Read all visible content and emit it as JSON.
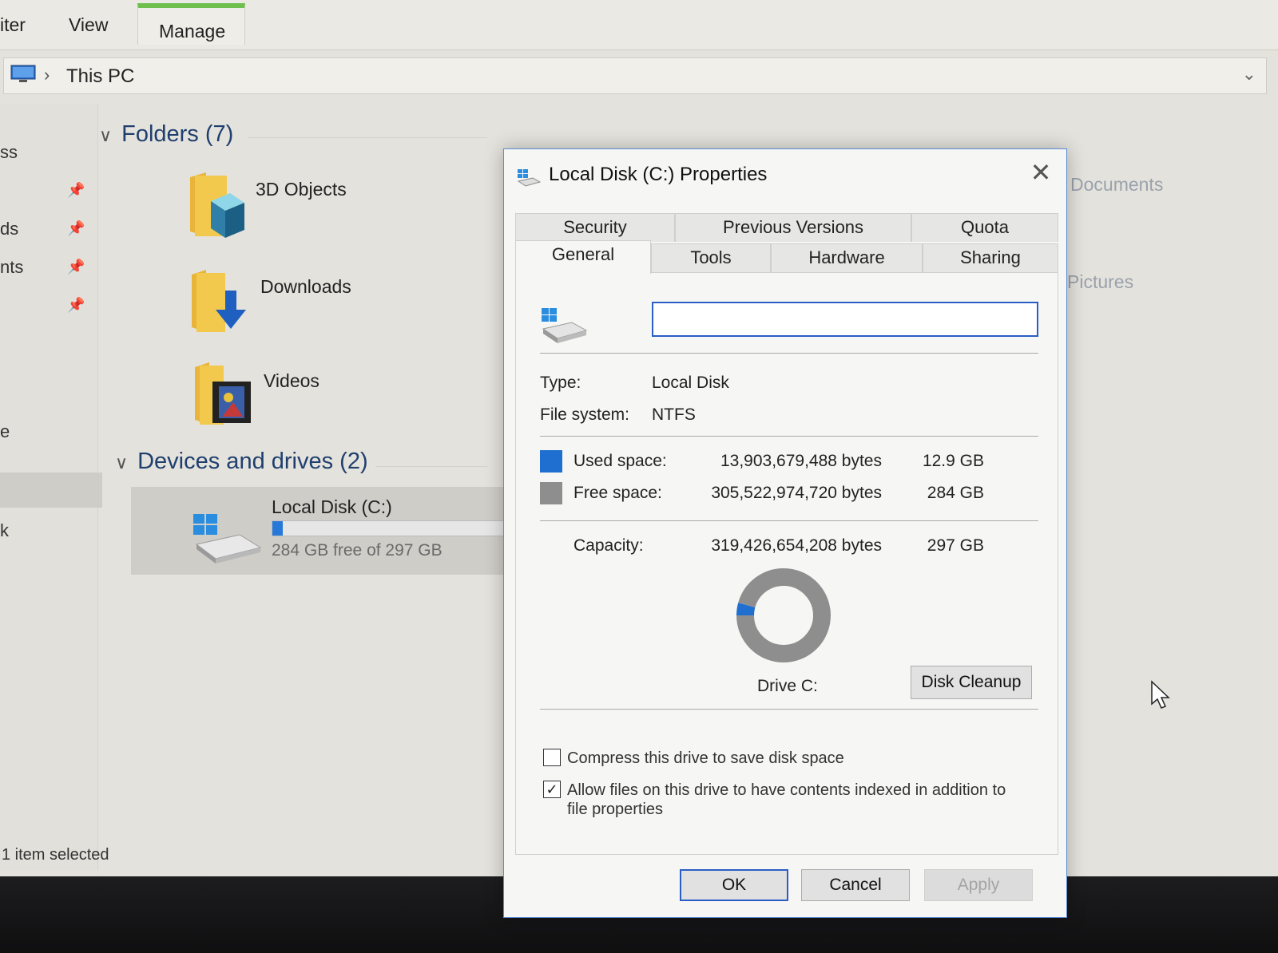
{
  "ribbon": {
    "tabs": [
      {
        "label": "iter"
      },
      {
        "label": "View"
      },
      {
        "label": "Manage"
      }
    ]
  },
  "address": {
    "separator": "›",
    "location": "This PC",
    "dropdown": "⌄"
  },
  "nav": {
    "items": [
      "ss",
      "ds",
      "nts",
      "",
      "e",
      "k"
    ]
  },
  "sections": {
    "folders": {
      "title": "Folders (7)"
    },
    "devices": {
      "title": "Devices and drives (2)"
    }
  },
  "folders": [
    {
      "name": "3D Objects"
    },
    {
      "name": "Downloads"
    },
    {
      "name": "Videos"
    }
  ],
  "right_column": [
    "Documents",
    "Pictures"
  ],
  "drive_tile": {
    "name": "Local Disk (C:)",
    "free_text": "284 GB free of 297 GB",
    "used_fraction": 0.043
  },
  "status": {
    "text": "1 item selected"
  },
  "dialog": {
    "title": "Local Disk (C:) Properties",
    "close": "✕",
    "tabs_row1": [
      "Security",
      "Previous Versions",
      "Quota"
    ],
    "tabs_row2": [
      "General",
      "Tools",
      "Hardware",
      "Sharing"
    ],
    "active_tab": "General",
    "volume_name": "",
    "type_label": "Type:",
    "type_value": "Local Disk",
    "fs_label": "File system:",
    "fs_value": "NTFS",
    "used": {
      "label": "Used space:",
      "bytes": "13,903,679,488 bytes",
      "size": "12.9 GB",
      "color": "#1f6fd0"
    },
    "free": {
      "label": "Free space:",
      "bytes": "305,522,974,720 bytes",
      "size": "284 GB",
      "color": "#8e8e8e"
    },
    "capacity": {
      "label": "Capacity:",
      "bytes": "319,426,654,208 bytes",
      "size": "297 GB"
    },
    "drive_label": "Drive C:",
    "disk_cleanup": "Disk Cleanup",
    "compress": {
      "label": "Compress this drive to save disk space",
      "checked": false
    },
    "index": {
      "label_line1": "Allow files on this drive to have contents indexed in addition to",
      "label_line2": "file properties",
      "checked": true
    },
    "buttons": {
      "ok": "OK",
      "cancel": "Cancel",
      "apply": "Apply"
    }
  },
  "chart_data": {
    "type": "pie",
    "categories": [
      "Used space",
      "Free space"
    ],
    "values": [
      13903679488,
      305522974720
    ],
    "colors": [
      "#1f6fd0",
      "#8e8e8e"
    ],
    "title": "Drive C:"
  }
}
